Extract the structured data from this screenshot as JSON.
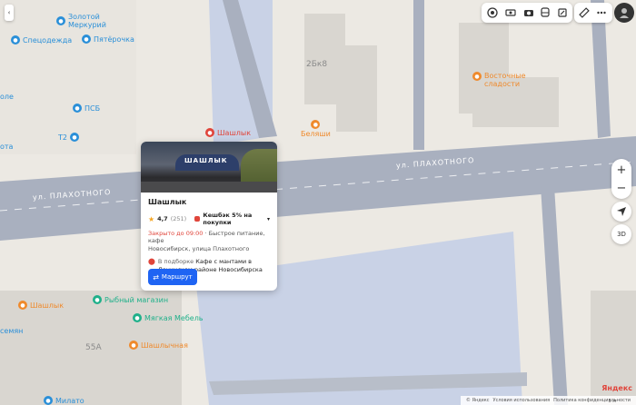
{
  "colors": {
    "road": "#a9b0bf",
    "water": "#c9d2e6",
    "block": "#ece9e3",
    "building": "#d6d2cc",
    "accent": "#1f64f3",
    "poi_blue": "#2a8fd8",
    "poi_orange": "#ef8a2c",
    "poi_red": "#e0453b",
    "poi_green": "#1fb08a",
    "closed": "#e0453b"
  },
  "map": {
    "street_main": "ул. ПЛАХОТНОГО",
    "street_left": "ул. ПЛАХОТНОГО",
    "buildings": {
      "b1": "2Бк8",
      "b2": "55А"
    },
    "pois": [
      {
        "name": "Золотой\nМеркурий",
        "icon": "tag-icon",
        "color": "#2a8fd8"
      },
      {
        "name": "Спецодежда",
        "icon": "tag-icon",
        "color": "#2a8fd8"
      },
      {
        "name": "Пятёрочка",
        "icon": "cart-icon",
        "color": "#2a8fd8"
      },
      {
        "name": "ПСБ",
        "icon": "bank-icon",
        "color": "#2a8fd8"
      },
      {
        "name": "Т2",
        "icon": "phone-icon",
        "color": "#2a8fd8"
      },
      {
        "name": "Шашлык",
        "icon": "food-icon",
        "color": "#e0453b"
      },
      {
        "name": "Беляши",
        "icon": "food-icon",
        "color": "#ef8a2c"
      },
      {
        "name": "Восточные\nсладости",
        "icon": "sweets-icon",
        "color": "#ef8a2c"
      },
      {
        "name": "Шашлык",
        "icon": "food-icon",
        "color": "#ef8a2c"
      },
      {
        "name": "Рыбный магазин",
        "icon": "fish-icon",
        "color": "#1fb08a"
      },
      {
        "name": "Мягкая Мебель",
        "icon": "sofa-icon",
        "color": "#1fb08a"
      },
      {
        "name": "Шашлычная",
        "icon": "food-icon",
        "color": "#ef8a2c"
      },
      {
        "name": "Милато",
        "icon": "tag-icon",
        "color": "#2a8fd8"
      },
      {
        "name": "семян",
        "icon": "tag-icon",
        "color": "#2a8fd8"
      },
      {
        "name": "оле",
        "icon": "tag-icon",
        "color": "#2a8fd8"
      },
      {
        "name": "ота",
        "icon": "tag-icon",
        "color": "#2a8fd8"
      }
    ]
  },
  "toolbar": {
    "icons": [
      "layers-icon",
      "panorama-icon",
      "camera-icon",
      "transport-icon",
      "traffic-icon",
      "ruler-icon",
      "more-icon",
      "profile-icon"
    ]
  },
  "zoom": {
    "plus": "+",
    "minus": "−",
    "mode3d": "3D"
  },
  "card": {
    "title": "Шашлык",
    "sign": "ШАШЛЫК",
    "rating": "4,7",
    "reviews": "(251)",
    "cashback": "Кешбэк 5% на покупки",
    "closed": "Закрыто до 09:00",
    "category": "· Быстрое питание, кафе",
    "address": "Новосибирск, улица Плахотного",
    "collection_prefix": "В подборке",
    "collection_name": "Кафе с мантами в Ленинском районе Новосибирска",
    "route_label": "Маршрут"
  },
  "footer": {
    "copyright": "© Яндекс",
    "terms": "Условия использования",
    "privacy": "Политика конфиденциальности",
    "scale": "5 м",
    "brand": "Яндекс"
  }
}
